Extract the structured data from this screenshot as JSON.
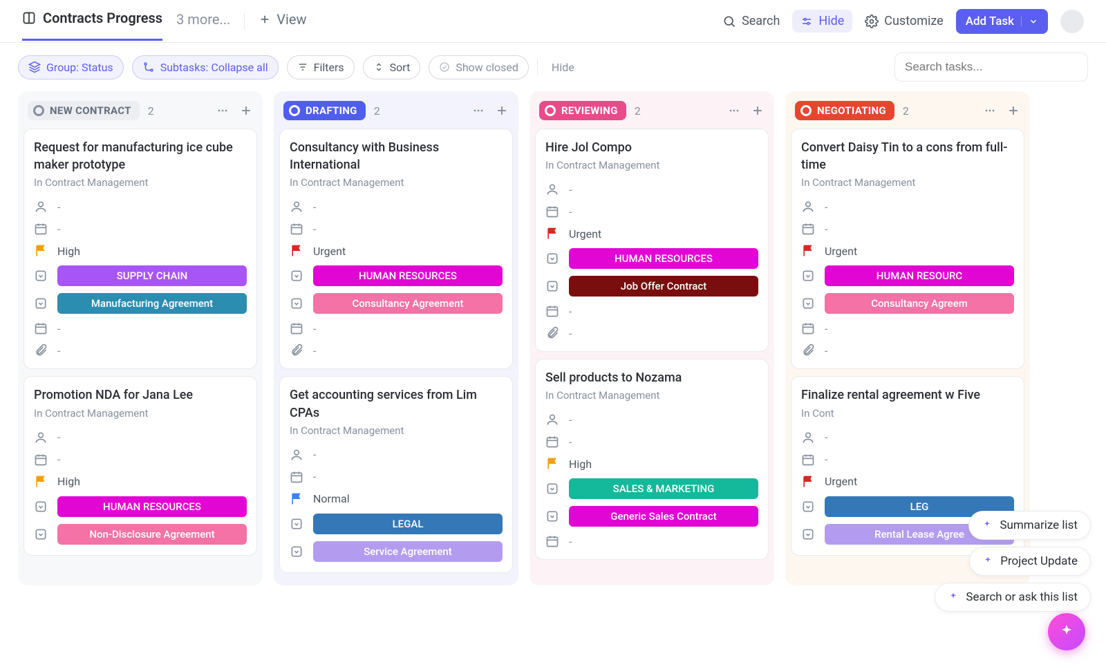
{
  "header": {
    "activeTab": "Contracts Progress",
    "moreTabs": "3 more...",
    "viewLabel": "View",
    "search": "Search",
    "hide": "Hide",
    "customize": "Customize",
    "addTask": "Add Task"
  },
  "toolbar": {
    "group": "Group: Status",
    "subtasks": "Subtasks: Collapse all",
    "filters": "Filters",
    "sort": "Sort",
    "showClosed": "Show closed",
    "hide": "Hide",
    "searchPlaceholder": "Search tasks..."
  },
  "columns": [
    {
      "id": "new",
      "label": "NEW CONTRACT",
      "count": "2",
      "chipClass": "chip-grey",
      "colClass": "col-grey",
      "cards": [
        {
          "title": "Request for manufacturing ice cube maker prototype",
          "sub": "In Contract Management",
          "assignee": "-",
          "date": "-",
          "priority": "High",
          "flagClass": "flag-orange",
          "badges": [
            {
              "text": "SUPPLY CHAIN",
              "cls": "b-purple"
            },
            {
              "text": "Manufacturing Agreement",
              "cls": "b-teal"
            }
          ],
          "extra": [
            "date",
            "attach"
          ]
        },
        {
          "title": "Promotion NDA for Jana Lee",
          "sub": "In Contract Management",
          "assignee": "-",
          "date": "-",
          "priority": "High",
          "flagClass": "flag-orange",
          "badges": [
            {
              "text": "HUMAN RESOURCES",
              "cls": "b-magenta"
            },
            {
              "text": "Non-Disclosure Agreement",
              "cls": "b-pink"
            }
          ],
          "extra": []
        }
      ]
    },
    {
      "id": "drafting",
      "label": "DRAFTING",
      "count": "2",
      "chipClass": "chip-blue",
      "colClass": "col-blue",
      "cards": [
        {
          "title": "Consultancy with Business International",
          "sub": "In Contract Management",
          "assignee": "-",
          "date": "-",
          "priority": "Urgent",
          "flagClass": "flag-red",
          "badges": [
            {
              "text": "HUMAN RESOURCES",
              "cls": "b-magenta"
            },
            {
              "text": "Consultancy Agreement",
              "cls": "b-pink"
            }
          ],
          "extra": [
            "date",
            "attach"
          ]
        },
        {
          "title": "Get accounting services from Lim CPAs",
          "sub": "In Contract Management",
          "assignee": "-",
          "date": "-",
          "priority": "Normal",
          "flagClass": "flag-blue",
          "badges": [
            {
              "text": "LEGAL",
              "cls": "b-blue"
            },
            {
              "text": "Service Agreement",
              "cls": "b-lav"
            }
          ],
          "extra": []
        }
      ]
    },
    {
      "id": "reviewing",
      "label": "REVIEWING",
      "count": "2",
      "chipClass": "chip-pink",
      "colClass": "col-pink",
      "cards": [
        {
          "title": "Hire Jol Compo",
          "sub": "In Contract Management",
          "assignee": "-",
          "date": "-",
          "priority": "Urgent",
          "flagClass": "flag-red",
          "badges": [
            {
              "text": "HUMAN RESOURCES",
              "cls": "b-magenta"
            },
            {
              "text": "Job Offer Contract",
              "cls": "b-darkred"
            }
          ],
          "extra": [
            "date",
            "attach"
          ]
        },
        {
          "title": "Sell products to Nozama",
          "sub": "In Contract Management",
          "assignee": "-",
          "date": "-",
          "priority": "High",
          "flagClass": "flag-orange",
          "badges": [
            {
              "text": "SALES & MARKETING",
              "cls": "b-green"
            },
            {
              "text": "Generic Sales Contract",
              "cls": "b-magenta"
            }
          ],
          "extra": [
            "date"
          ]
        }
      ]
    },
    {
      "id": "negotiating",
      "label": "NEGOTIATING",
      "count": "2",
      "chipClass": "chip-orange",
      "colClass": "col-orange",
      "cards": [
        {
          "title": "Convert Daisy Tin to a cons from full-time",
          "sub": "In Contract Management",
          "assignee": "-",
          "date": "-",
          "priority": "Urgent",
          "flagClass": "flag-red",
          "badges": [
            {
              "text": "HUMAN RESOURC",
              "cls": "b-magenta"
            },
            {
              "text": "Consultancy Agreem",
              "cls": "b-pink"
            }
          ],
          "extra": [
            "date",
            "attach"
          ]
        },
        {
          "title": "Finalize rental agreement w Five",
          "sub": "In Cont",
          "assignee": "-",
          "date": "-",
          "priority": "Urgent",
          "flagClass": "flag-red",
          "badges": [
            {
              "text": "LEG",
              "cls": "b-blue"
            },
            {
              "text": "Rental Lease Agree",
              "cls": "b-lav"
            }
          ],
          "extra": []
        }
      ]
    }
  ],
  "ai": {
    "summarize": "Summarize list",
    "project": "Project Update",
    "search": "Search or ask this list"
  }
}
